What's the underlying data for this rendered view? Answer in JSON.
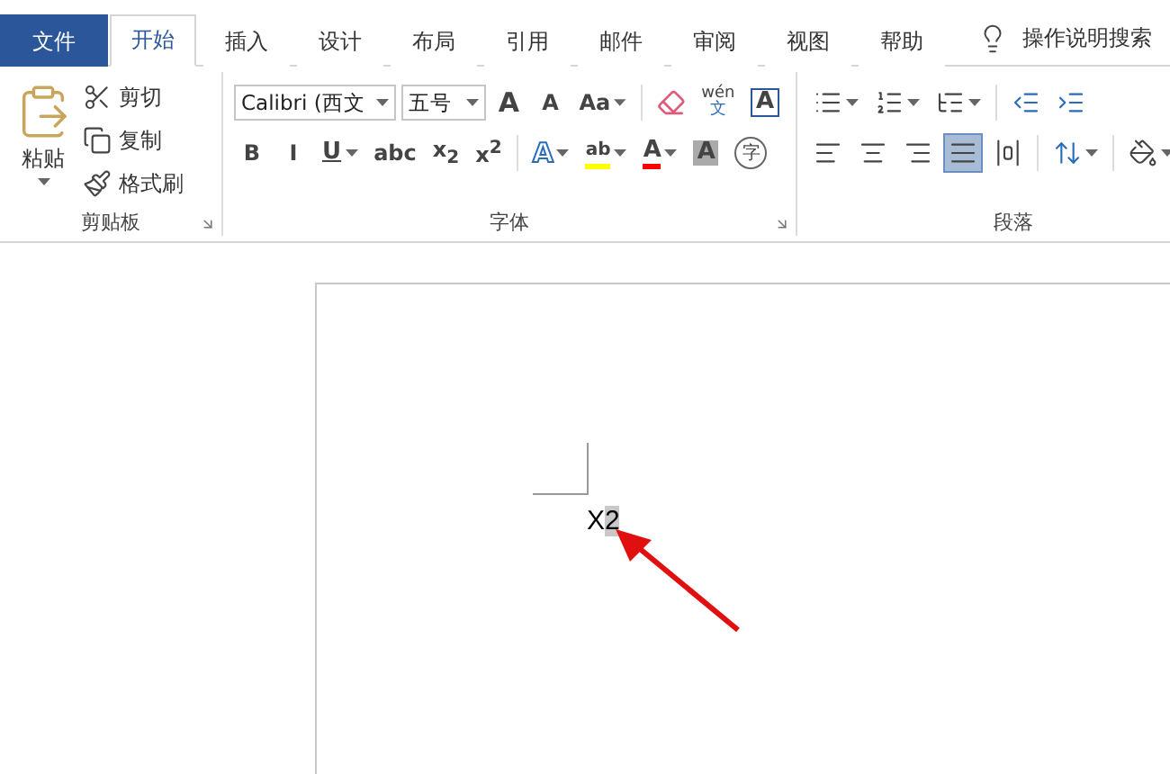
{
  "tabs": [
    {
      "label": "文件",
      "kind": "file",
      "selected": false
    },
    {
      "label": "开始",
      "kind": "tab",
      "selected": true
    },
    {
      "label": "插入",
      "kind": "tab",
      "selected": false
    },
    {
      "label": "设计",
      "kind": "tab",
      "selected": false
    },
    {
      "label": "布局",
      "kind": "tab",
      "selected": false
    },
    {
      "label": "引用",
      "kind": "tab",
      "selected": false
    },
    {
      "label": "邮件",
      "kind": "tab",
      "selected": false
    },
    {
      "label": "审阅",
      "kind": "tab",
      "selected": false
    },
    {
      "label": "视图",
      "kind": "tab",
      "selected": false
    },
    {
      "label": "帮助",
      "kind": "tab",
      "selected": false
    }
  ],
  "tell_me": "操作说明搜索",
  "clipboard": {
    "title": "剪贴板",
    "paste": "粘贴",
    "items": [
      "剪切",
      "复制",
      "格式刷"
    ]
  },
  "font": {
    "title": "字体",
    "font_name": "Calibri (西文",
    "font_size": "五号",
    "row1": [
      {
        "kind": "grow",
        "label": "A"
      },
      {
        "kind": "shrink",
        "label": "A"
      },
      {
        "kind": "case",
        "label": "Aa"
      },
      {
        "kind": "clear"
      },
      {
        "kind": "phonetic",
        "label": "wén",
        "sub": "文"
      },
      {
        "kind": "border",
        "label": "A"
      }
    ],
    "row2": [
      {
        "kind": "plain",
        "label": "B"
      },
      {
        "kind": "plain",
        "label": "I"
      },
      {
        "kind": "underline",
        "label": "U"
      },
      {
        "kind": "plain",
        "label": "abc"
      },
      {
        "kind": "plain",
        "label": "x$_{2}$"
      },
      {
        "kind": "plain",
        "label": "x$^{2}$"
      },
      {
        "kind": "effect",
        "label": "A"
      },
      {
        "kind": "highlight",
        "label": "ab",
        "color": "#ffff00"
      },
      {
        "kind": "color",
        "label": "A",
        "color": "#ff0000"
      },
      {
        "kind": "shade",
        "label": "A"
      },
      {
        "kind": "enclose",
        "label": "字"
      }
    ]
  },
  "paragraph": {
    "title": "段落",
    "alignments": [
      {
        "kind": "left",
        "selected": false
      },
      {
        "kind": "center",
        "selected": false
      },
      {
        "kind": "right",
        "selected": false
      },
      {
        "kind": "justify",
        "selected": true
      },
      {
        "kind": "distributed",
        "selected": false
      }
    ]
  },
  "document": {
    "text": [
      {
        "text": "X",
        "selected": false
      },
      {
        "text": "2",
        "selected": true
      }
    ]
  }
}
